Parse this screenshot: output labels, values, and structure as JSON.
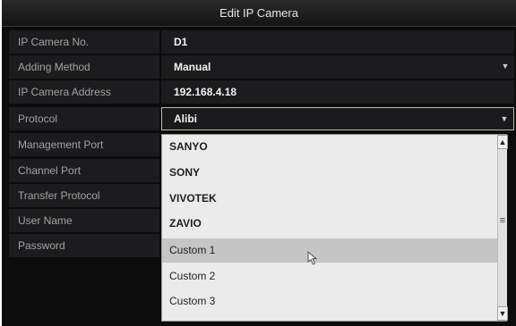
{
  "dialog": {
    "title": "Edit IP Camera"
  },
  "fields": [
    {
      "label": "IP Camera No.",
      "value": "D1"
    },
    {
      "label": "Adding Method",
      "value": "Manual"
    },
    {
      "label": "IP Camera Address",
      "value": "192.168.4.18"
    },
    {
      "label": "Protocol",
      "value": "Alibi"
    }
  ],
  "hidden_fields": [
    {
      "label": "Management Port"
    },
    {
      "label": "Channel Port"
    },
    {
      "label": "Transfer Protocol"
    },
    {
      "label": "User Name"
    },
    {
      "label": "Password"
    }
  ],
  "dropdown": {
    "options": [
      "SANYO",
      "SONY",
      "VIVOTEK",
      "ZAVIO",
      "Custom 1",
      "Custom 2",
      "Custom 3"
    ],
    "highlighted": "Custom 1"
  },
  "icons": {
    "chevron": "chevron-down-icon",
    "scroll_up": "chevron-up-icon",
    "scroll_down": "chevron-down-icon",
    "grip": "drag-handle-icon",
    "cursor": "mouse-pointer-icon"
  },
  "colors": {
    "focus_border": "#c9c26a",
    "highlight": "#c5c5c5"
  }
}
